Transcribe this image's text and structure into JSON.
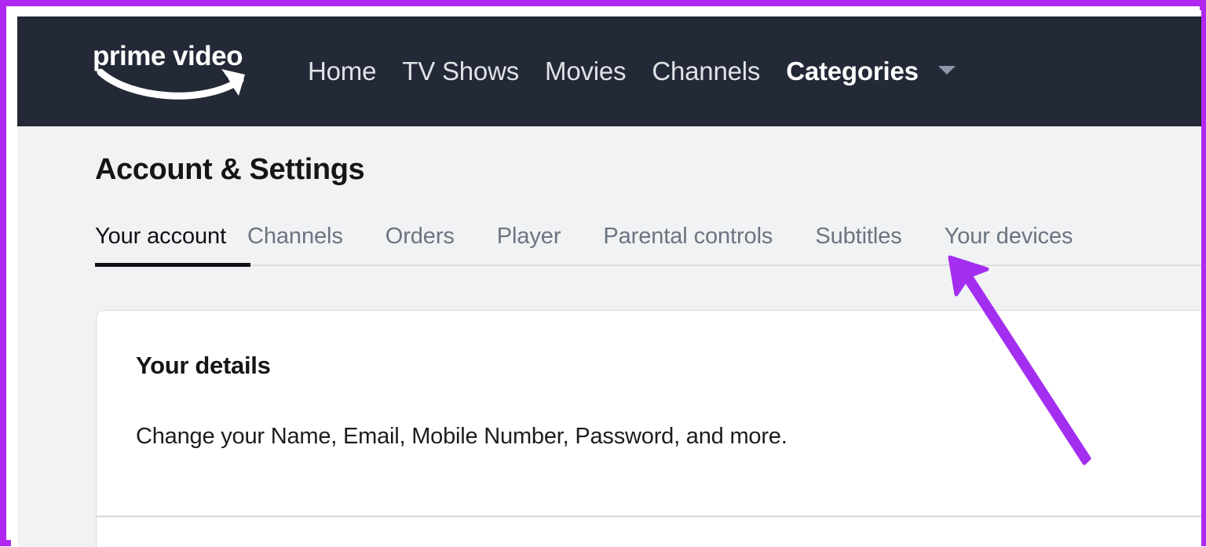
{
  "annotation": {
    "frame_color": "#b028f0",
    "arrow_color": "#a32ef0",
    "arrow_points_to": "Subtitles"
  },
  "navbar": {
    "background": "#232936",
    "logo": {
      "text": "prime video",
      "icon": "amazon-smile-swoosh"
    },
    "links": [
      {
        "label": "Home",
        "active": false
      },
      {
        "label": "TV Shows",
        "active": false
      },
      {
        "label": "Movies",
        "active": false
      },
      {
        "label": "Channels",
        "active": false
      },
      {
        "label": "Categories",
        "active": true,
        "caret": "chevron-down-icon"
      }
    ]
  },
  "page": {
    "background": "#f1f2f4",
    "title": "Account & Settings",
    "tabs": [
      {
        "label": "Your account",
        "selected": true
      },
      {
        "label": "Channels",
        "selected": false
      },
      {
        "label": "Orders",
        "selected": false
      },
      {
        "label": "Player",
        "selected": false
      },
      {
        "label": "Parental controls",
        "selected": false
      },
      {
        "label": "Subtitles",
        "selected": false
      },
      {
        "label": "Your devices",
        "selected": false
      }
    ],
    "card": {
      "sections": [
        {
          "title": "Your details",
          "description": "Change your Name, Email, Mobile Number, Password, and more."
        }
      ]
    }
  }
}
